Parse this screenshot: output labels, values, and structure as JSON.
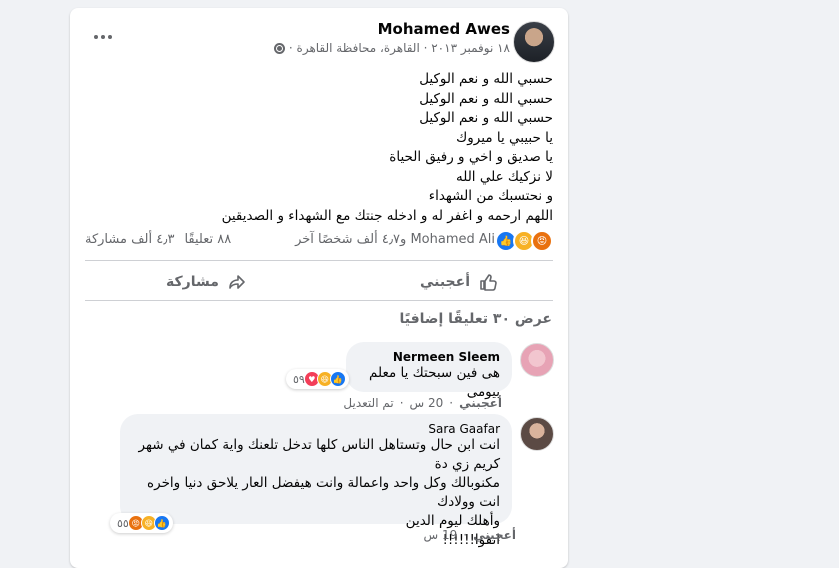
{
  "post": {
    "author": "Mohamed Awes",
    "meta": "١٨ نوفمبر ٢٠١٣ · القاهرة، محافظة القاهرة ·",
    "body_lines": [
      "حسبي الله و نعم الوكيل",
      "حسبي الله و نعم الوكيل",
      "حسبي الله و نعم الوكيل",
      "يا حبيبي يا ميروك",
      "يا صديق و اخي و رفيق الحياة",
      "لا نزكيك علي الله",
      "و نحتسبك من الشهداء",
      "اللهم ارحمه و اغفر له و ادخله جنتك مع الشهداء و الصديقين"
    ],
    "reaction_names": "Mohamed Ali و٤٫٧ ألف شخصًا آخر",
    "comments_count": "٨٨ تعليقًا",
    "shares_count": "٤٫٣ ألف مشاركة",
    "like_label": "أعجبني",
    "share_label": "مشاركة",
    "view_more": "عرض ٣٠ تعليقًا إضافيًا"
  },
  "comments": [
    {
      "name": "Nermeen Sleem",
      "text": "هى فين سبحتك يا معلم بيومى",
      "react_count": "٥٩",
      "like_label": "أعجبني",
      "time": "20 س",
      "edited": "تم التعديل"
    },
    {
      "name": "Sara Gaafar",
      "text_lines": [
        "انت ابن حال وتستاهل الناس كلها تدخل تلعنك واية كمان في شهر كريم زي دة",
        "مكنوبالك وكل واحد واعمالة وانت هيفضل العار يلاحق دنيا واخره انت وولادك",
        "وأهلك ليوم الدين",
        "اتفوا!!!!!!"
      ],
      "react_count": "٥٥",
      "like_label": "أعجبني",
      "time": "19 س"
    }
  ],
  "colors": {
    "like_blue": "#1877f2",
    "haha_yellow": "#f7b125",
    "angry_orange": "#e9710f",
    "love_red": "#f33e58",
    "secondary_text": "#65676b"
  },
  "icons": [
    "more-icon",
    "globe-icon",
    "like-icon",
    "share-icon",
    "angry-icon",
    "haha-icon",
    "love-icon"
  ]
}
